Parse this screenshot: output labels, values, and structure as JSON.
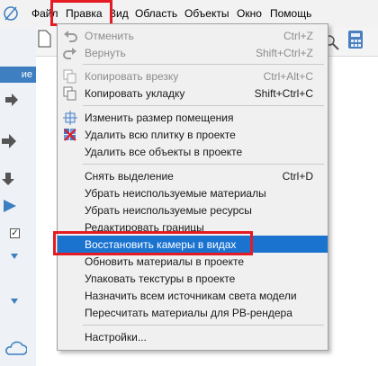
{
  "menubar": {
    "items": [
      {
        "label": "Файл"
      },
      {
        "label": "Правка"
      },
      {
        "label": "Вид"
      },
      {
        "label": "Область"
      },
      {
        "label": "Объекты"
      },
      {
        "label": "Окно"
      },
      {
        "label": "Помощь"
      }
    ],
    "open_item": "Правка"
  },
  "left_panel": {
    "tab_label": "ие"
  },
  "edit_menu": {
    "groups": [
      [
        {
          "label": "Отменить",
          "shortcut": "Ctrl+Z",
          "icon": "undo-icon",
          "disabled": true
        },
        {
          "label": "Вернуть",
          "shortcut": "Shift+Ctrl+Z",
          "icon": "redo-icon",
          "disabled": true
        }
      ],
      [
        {
          "label": "Копировать врезку",
          "shortcut": "Ctrl+Alt+C",
          "icon": "copy-inset-icon",
          "disabled": true
        },
        {
          "label": "Копировать укладку",
          "shortcut": "Shift+Ctrl+C",
          "icon": "copy-layout-icon",
          "disabled": false
        }
      ],
      [
        {
          "label": "Изменить размер помещения",
          "shortcut": "",
          "icon": "resize-room-icon",
          "disabled": false
        },
        {
          "label": "Удалить всю плитку в проекте",
          "shortcut": "",
          "icon": "delete-tiles-icon",
          "disabled": false
        },
        {
          "label": "Удалить все объекты в проекте",
          "shortcut": "",
          "icon": "",
          "disabled": false
        }
      ],
      [
        {
          "label": "Снять выделение",
          "shortcut": "Ctrl+D",
          "icon": "",
          "disabled": false
        },
        {
          "label": "Убрать неиспользуемые материалы",
          "shortcut": "",
          "icon": "",
          "disabled": false
        },
        {
          "label": "Убрать неиспользуемые ресурсы",
          "shortcut": "",
          "icon": "",
          "disabled": false
        },
        {
          "label": "Редактировать границы",
          "shortcut": "",
          "icon": "",
          "disabled": false
        },
        {
          "label": "Восстановить камеры в видах",
          "shortcut": "",
          "icon": "",
          "disabled": false,
          "selected": true
        },
        {
          "label": "Обновить материалы в проекте",
          "shortcut": "",
          "icon": "",
          "disabled": false
        },
        {
          "label": "Упаковать текстуры в проекте",
          "shortcut": "",
          "icon": "",
          "disabled": false
        },
        {
          "label": "Назначить всем  источникам света модели",
          "shortcut": "",
          "icon": "",
          "disabled": false
        },
        {
          "label": "Пересчитать материалы для PB-рендера",
          "shortcut": "",
          "icon": "",
          "disabled": false
        }
      ],
      [
        {
          "label": "Настройки...",
          "shortcut": "",
          "icon": "",
          "disabled": false
        }
      ]
    ]
  },
  "colors": {
    "selection": "#1b73d0",
    "highlight_box": "#e41b23",
    "left_tab": "#3d7fc1"
  }
}
